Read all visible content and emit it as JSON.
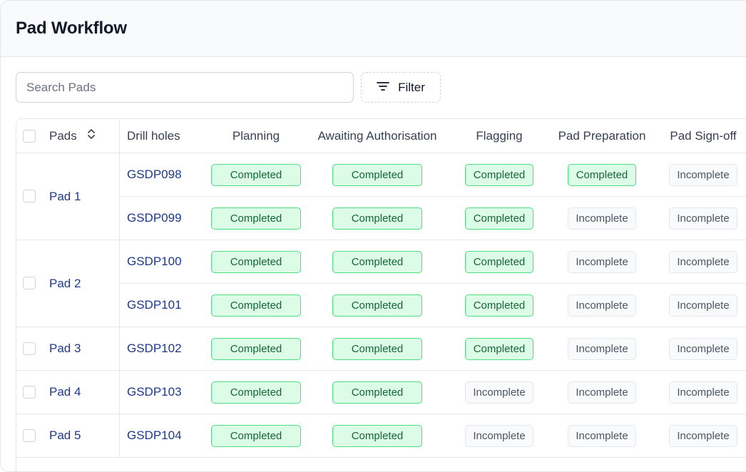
{
  "page": {
    "title": "Pad Workflow"
  },
  "toolbar": {
    "search_placeholder": "Search Pads",
    "filter_label": "Filter",
    "filter_icon": "filter-lines-icon"
  },
  "table": {
    "columns": {
      "pads": "Pads",
      "drill_holes": "Drill holes",
      "planning": "Planning",
      "awaiting": "Awaiting Authorisation",
      "flagging": "Flagging",
      "preparation": "Pad Preparation",
      "signoff": "Pad Sign-off"
    },
    "sort_icon": "sort-icon",
    "pads": [
      {
        "name": "Pad 1",
        "holes": [
          {
            "id": "GSDP098",
            "planning": "Completed",
            "awaiting": "Completed",
            "flagging": "Completed",
            "preparation": "Completed",
            "signoff": "Incomplete"
          },
          {
            "id": "GSDP099",
            "planning": "Completed",
            "awaiting": "Completed",
            "flagging": "Completed",
            "preparation": "Incomplete",
            "signoff": "Incomplete"
          }
        ]
      },
      {
        "name": "Pad 2",
        "holes": [
          {
            "id": "GSDP100",
            "planning": "Completed",
            "awaiting": "Completed",
            "flagging": "Completed",
            "preparation": "Incomplete",
            "signoff": "Incomplete"
          },
          {
            "id": "GSDP101",
            "planning": "Completed",
            "awaiting": "Completed",
            "flagging": "Completed",
            "preparation": "Incomplete",
            "signoff": "Incomplete"
          }
        ]
      },
      {
        "name": "Pad 3",
        "holes": [
          {
            "id": "GSDP102",
            "planning": "Completed",
            "awaiting": "Completed",
            "flagging": "Completed",
            "preparation": "Incomplete",
            "signoff": "Incomplete"
          }
        ]
      },
      {
        "name": "Pad 4",
        "holes": [
          {
            "id": "GSDP103",
            "planning": "Completed",
            "awaiting": "Completed",
            "flagging": "Incomplete",
            "preparation": "Incomplete",
            "signoff": "Incomplete"
          }
        ]
      },
      {
        "name": "Pad 5",
        "holes": [
          {
            "id": "GSDP104",
            "planning": "Completed",
            "awaiting": "Completed",
            "flagging": "Incomplete",
            "preparation": "Incomplete",
            "signoff": "Incomplete"
          }
        ]
      }
    ]
  },
  "colors": {
    "completed_bg": "#dcfce7",
    "completed_border": "#4ade80",
    "completed_text": "#166534",
    "incomplete_bg": "#f9fafb",
    "incomplete_border": "#e5e7eb",
    "incomplete_text": "#4b5563",
    "link": "#1e3a8a"
  }
}
